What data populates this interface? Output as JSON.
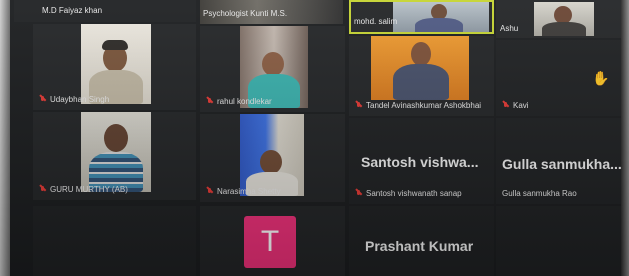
{
  "meeting": {
    "participants": [
      {
        "name": "M.D Faiyaz khan",
        "muted": false
      },
      {
        "name": "Psychologist Kunti M.S.",
        "muted": false
      },
      {
        "name": "mohd. salim",
        "muted": false
      },
      {
        "name": "Ashu",
        "muted": false
      },
      {
        "name": "Udaybhan Singh",
        "muted": true
      },
      {
        "name": "rahul kondlekar",
        "muted": true
      },
      {
        "name": "Tandel Avinashkumar Ashokbhai",
        "muted": true
      },
      {
        "name": "Kavi",
        "muted": true
      },
      {
        "name": "GURU MURTHY (AB)",
        "muted": true
      },
      {
        "name": "Narasimha Shetty",
        "muted": true
      },
      {
        "name": "Santosh vishwanath sanap",
        "display_title": "Santosh vishwa...",
        "muted": true
      },
      {
        "name": "Gulla sanmukha Rao",
        "display_title": "Gulla sanmukha...",
        "muted": false
      },
      {
        "name": "Prashant Kumar",
        "avatar_letter": "T",
        "muted": false
      }
    ],
    "accent": "#c5d432",
    "avatar_color": "#f0307a",
    "muted_icon": "mic-off-icon",
    "raise_hand_icon": "raise-hand-icon"
  }
}
